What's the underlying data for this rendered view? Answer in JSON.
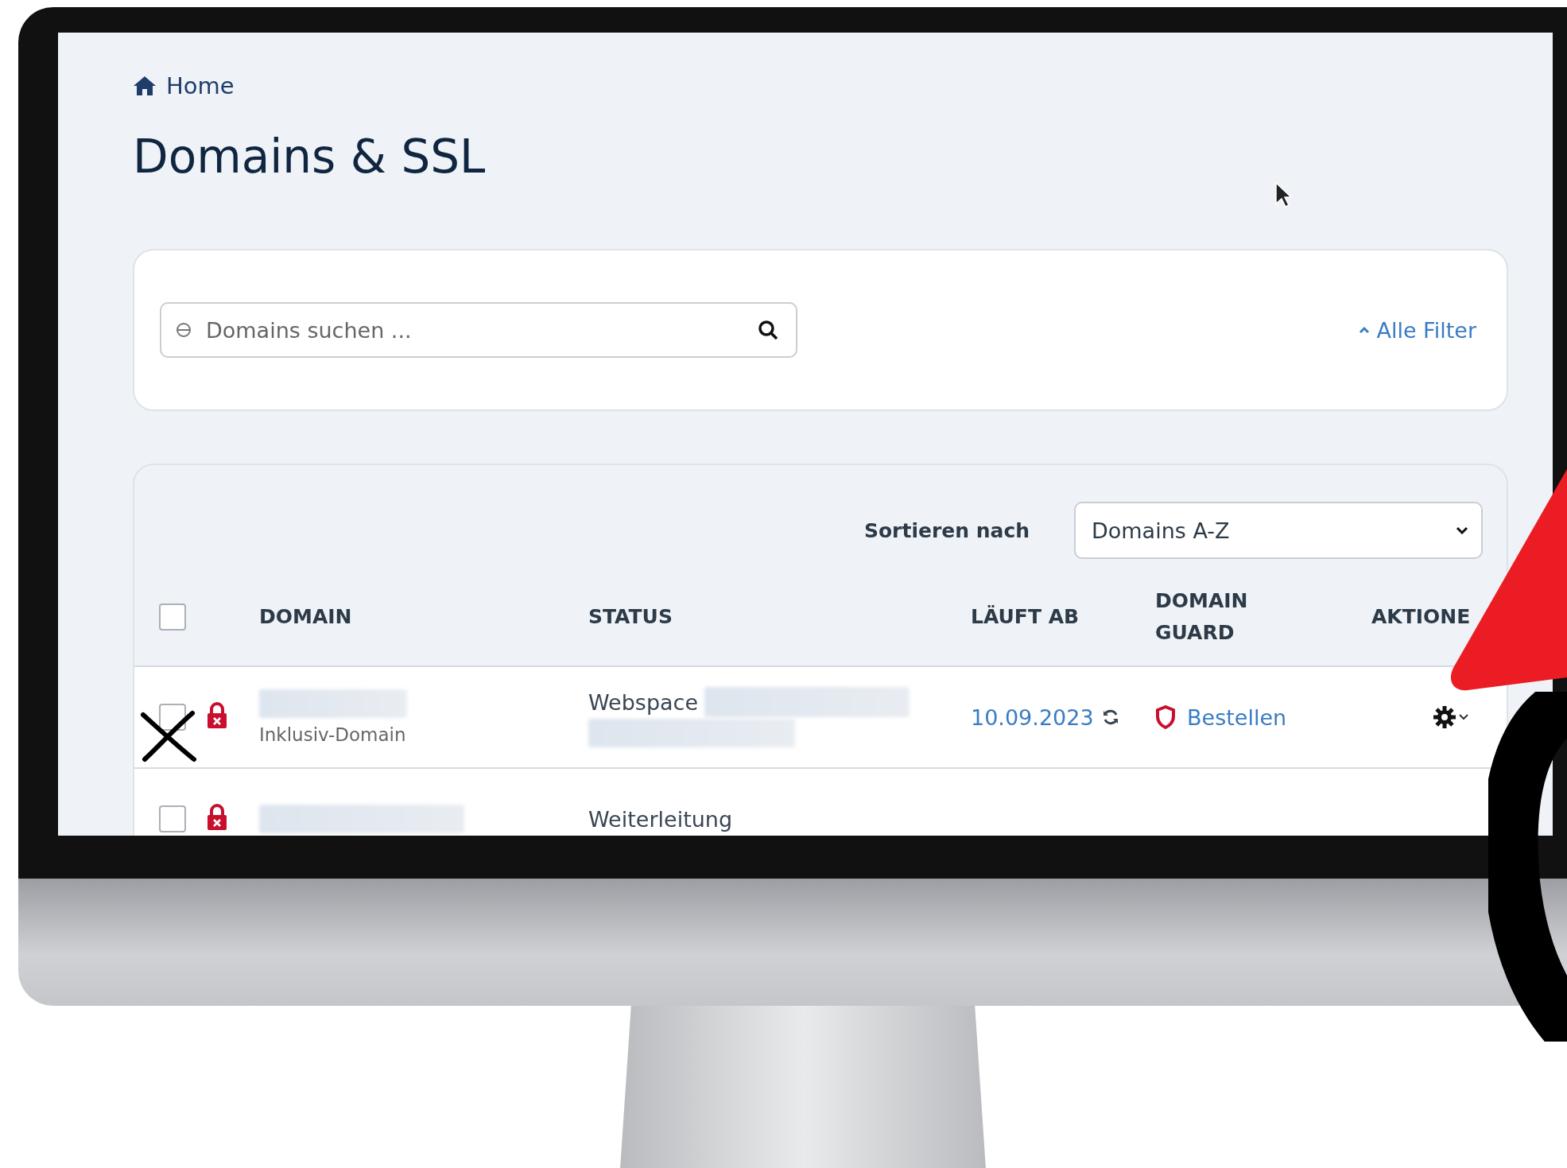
{
  "breadcrumb": {
    "label": "Home"
  },
  "title": "Domains & SSL",
  "search": {
    "placeholder": "Domains suchen ..."
  },
  "filter_toggle": {
    "label": "Alle Filter",
    "expanded": true
  },
  "sort": {
    "label": "Sortieren nach",
    "value": "Domains A-Z"
  },
  "table": {
    "select_all": {
      "checked": false
    },
    "columns": [
      "DOMAIN",
      "STATUS",
      "LÄUFT AB",
      "DOMAIN GUARD",
      "AKTIONE"
    ],
    "rows": [
      {
        "checked": false,
        "domain_note": "Inklusiv-Domain",
        "status": "Webspace",
        "expires": "10.09.2023",
        "guard": "Bestellen"
      },
      {
        "checked": false,
        "status": "Weiterleitung"
      }
    ]
  }
}
